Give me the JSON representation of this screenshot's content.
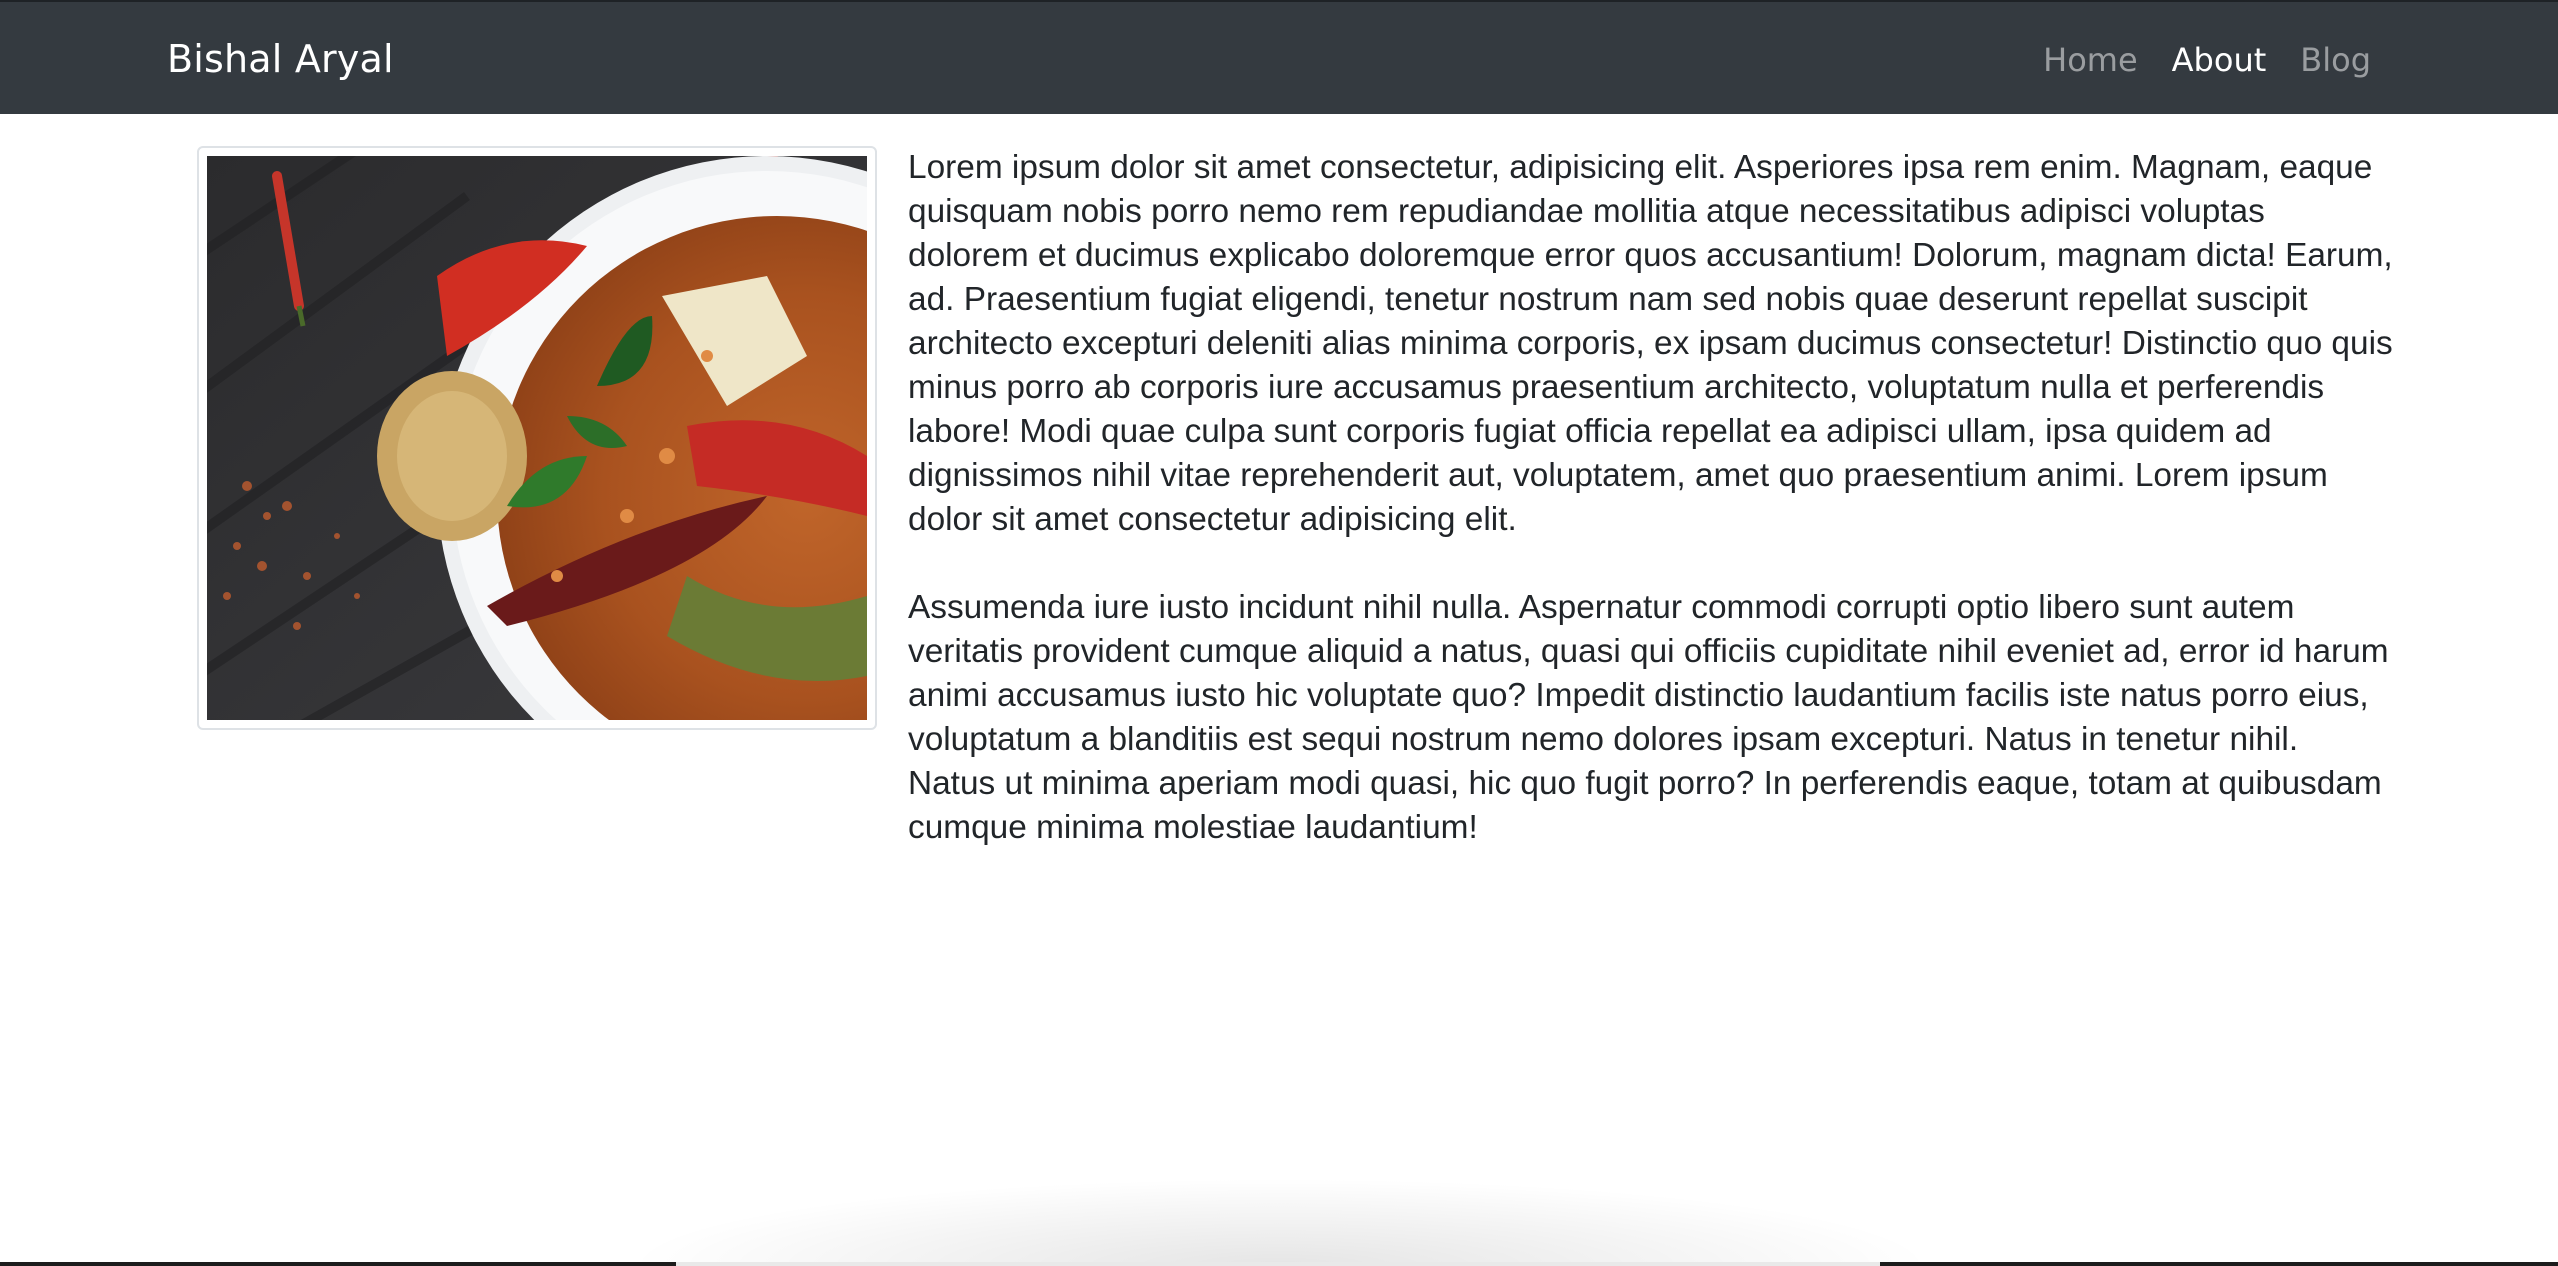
{
  "navbar": {
    "brand": "Bishal Aryal",
    "links": [
      {
        "label": "Home",
        "active": false
      },
      {
        "label": "About",
        "active": true
      },
      {
        "label": "Blog",
        "active": false
      }
    ],
    "background": "#343a40"
  },
  "main": {
    "image": {
      "subject": "bowl of red curry with basil and chili peppers"
    },
    "paragraphs": [
      "Lorem ipsum dolor sit amet consectetur, adipisicing elit. Asperiores ipsa rem enim. Magnam, eaque quisquam nobis porro nemo rem repudiandae mollitia atque necessitatibus adipisci voluptas dolorem et ducimus explicabo doloremque error quos accusantium! Dolorum, magnam dicta! Earum, ad. Praesentium fugiat eligendi, tenetur nostrum nam sed nobis quae deserunt repellat suscipit architecto excepturi deleniti alias minima corporis, ex ipsam ducimus consectetur! Distinctio quo quis minus porro ab corporis iure accusamus praesentium architecto, voluptatum nulla et perferendis labore! Modi quae culpa sunt corporis fugiat officia repellat ea adipisci ullam, ipsa quidem ad dignissimos nihil vitae reprehenderit aut, voluptatem, amet quo praesentium animi. Lorem ipsum dolor sit amet consectetur adipisicing elit.",
      "Assumenda iure iusto incidunt nihil nulla. Aspernatur commodi corrupti optio libero sunt autem veritatis provident cumque aliquid a natus, quasi qui officiis cupiditate nihil eveniet ad, error id harum animi accusamus iusto hic voluptate quo? Impedit distinctio laudantium facilis iste natus porro eius, voluptatum a blanditiis est sequi nostrum nemo dolores ipsam excepturi. Natus in tenetur nihil. Natus ut minima aperiam modi quasi, hic quo fugit porro? In perferendis eaque, totam at quibusdam cumque minima molestiae laudantium!"
    ]
  }
}
